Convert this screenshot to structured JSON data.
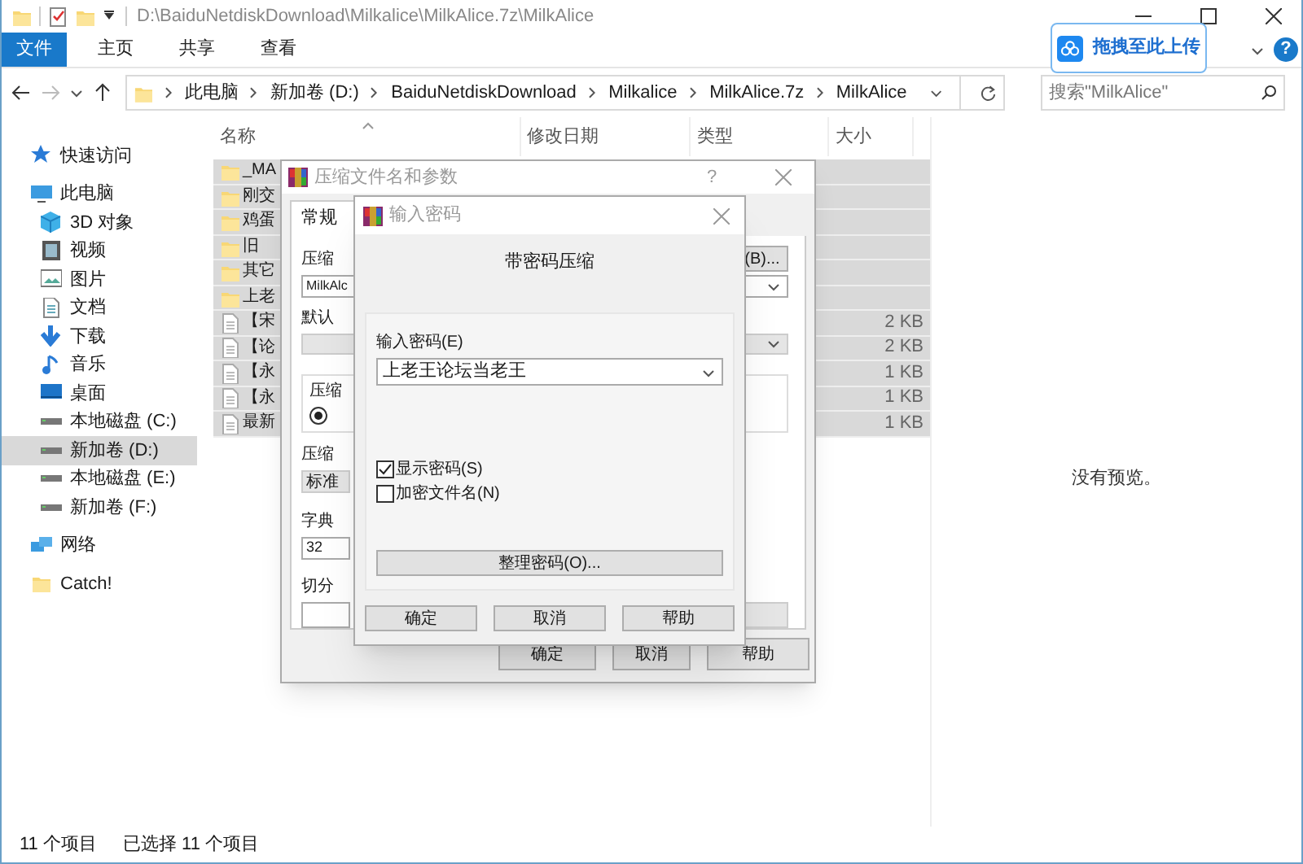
{
  "window": {
    "title": "D:\\BaiduNetdiskDownload\\Milkalice\\MilkAlice.7z\\MilkAlice"
  },
  "ribbon": {
    "tabs": [
      {
        "label": "文件",
        "selected": true
      },
      {
        "label": "主页",
        "selected": false
      },
      {
        "label": "共享",
        "selected": false
      },
      {
        "label": "查看",
        "selected": false
      }
    ],
    "help": "?"
  },
  "upload_button": {
    "label": "拖拽至此上传"
  },
  "breadcrumb": [
    "此电脑",
    "新加卷 (D:)",
    "BaiduNetdiskDownload",
    "Milkalice",
    "MilkAlice.7z",
    "MilkAlice"
  ],
  "search": {
    "placeholder": "搜索\"MilkAlice\""
  },
  "sidebar": {
    "items": [
      {
        "label": "快速访问",
        "kind": "star",
        "selected": false
      },
      {
        "label": "此电脑",
        "kind": "pc",
        "selected": false,
        "children": [
          {
            "label": "3D 对象",
            "kind": "cube",
            "selected": false
          },
          {
            "label": "视频",
            "kind": "film",
            "selected": false
          },
          {
            "label": "图片",
            "kind": "image",
            "selected": false
          },
          {
            "label": "文档",
            "kind": "doc",
            "selected": false
          },
          {
            "label": "下载",
            "kind": "download",
            "selected": false
          },
          {
            "label": "音乐",
            "kind": "music",
            "selected": false
          },
          {
            "label": "桌面",
            "kind": "desktop",
            "selected": false
          },
          {
            "label": "本地磁盘 (C:)",
            "kind": "drive",
            "selected": false
          },
          {
            "label": "新加卷 (D:)",
            "kind": "drive",
            "selected": true
          },
          {
            "label": "本地磁盘 (E:)",
            "kind": "drive",
            "selected": false
          },
          {
            "label": "新加卷 (F:)",
            "kind": "drive",
            "selected": false
          }
        ]
      },
      {
        "label": "网络",
        "kind": "network",
        "selected": false
      },
      {
        "label": "Catch!",
        "kind": "folder",
        "selected": false
      }
    ]
  },
  "file_list": {
    "columns": [
      "名称",
      "修改日期",
      "类型",
      "大小"
    ],
    "rows": [
      {
        "name": "_MA",
        "kind": "folder",
        "selected": true
      },
      {
        "name": "刚交",
        "kind": "folder",
        "selected": true
      },
      {
        "name": "鸡蛋",
        "kind": "folder",
        "selected": true
      },
      {
        "name": "旧",
        "kind": "folder",
        "selected": true
      },
      {
        "name": "其它",
        "kind": "folder",
        "selected": true
      },
      {
        "name": "上老",
        "kind": "folder",
        "selected": true
      },
      {
        "name": "【宋",
        "kind": "file",
        "size": "2 KB",
        "selected": true
      },
      {
        "name": "【论",
        "kind": "file",
        "size": "2 KB",
        "selected": true
      },
      {
        "name": "【永",
        "kind": "file",
        "size": "1 KB",
        "selected": true
      },
      {
        "name": "【永",
        "kind": "file",
        "size": "1 KB",
        "selected": true
      },
      {
        "name": "最新",
        "kind": "file",
        "size": "1 KB",
        "selected": true
      }
    ]
  },
  "preview": {
    "message": "没有预览。"
  },
  "status_bar": {
    "item_count": "11 个项目",
    "selection": "已选择 11 个项目"
  },
  "archive_dialog": {
    "title": "压缩文件名和参数",
    "help": "?",
    "tab": {
      "label": "常规",
      "selected": true
    },
    "archive_name_label": "压缩",
    "browse_button": "(B)...",
    "archive_name_value": "MilkAlc",
    "profile_label": "默认",
    "format_group_label": "压缩",
    "format_radio_checked": true,
    "method_label": "压缩",
    "method_value": "标准",
    "dictionary_label": "字典",
    "dictionary_value": "32",
    "split_label": "切分",
    "buttons": [
      "确定",
      "取消",
      "帮助"
    ]
  },
  "password_dialog": {
    "title": "输入密码",
    "heading": "带密码压缩",
    "password_label": "输入密码(E)",
    "password_value": "上老王论坛当老王",
    "options": [
      {
        "label": "显示密码(S)",
        "checked": true
      },
      {
        "label": "加密文件名(N)",
        "checked": false
      }
    ],
    "organize_button": "整理密码(O)...",
    "buttons": [
      "确定",
      "取消",
      "帮助"
    ]
  }
}
